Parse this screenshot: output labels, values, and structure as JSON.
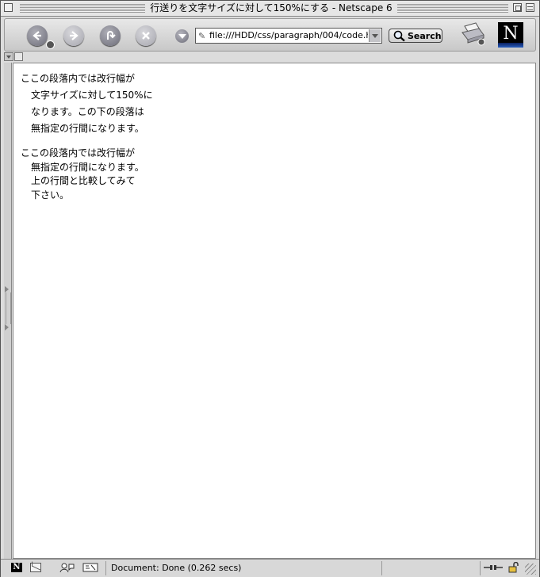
{
  "window": {
    "title": "行送りを文字サイズに対して150%にする - Netscape 6"
  },
  "toolbar": {
    "back_icon": "back-arrow-icon",
    "forward_icon": "forward-arrow-icon",
    "reload_icon": "reload-icon",
    "stop_icon": "stop-icon",
    "url": "file:///HDD/css/paragraph/004/code.htm",
    "search_label": "Search"
  },
  "content": {
    "paragraph1": [
      "ここの段落内では改行幅が",
      "文字サイズに対して150%に",
      "なります。この下の段落は",
      "無指定の行間になります。"
    ],
    "paragraph2": [
      "ここの段落内では改行幅が",
      "無指定の行間になります。",
      "上の行間と比較してみて",
      "下さい。"
    ]
  },
  "statusbar": {
    "status": "Document: Done (0.262 secs)"
  }
}
